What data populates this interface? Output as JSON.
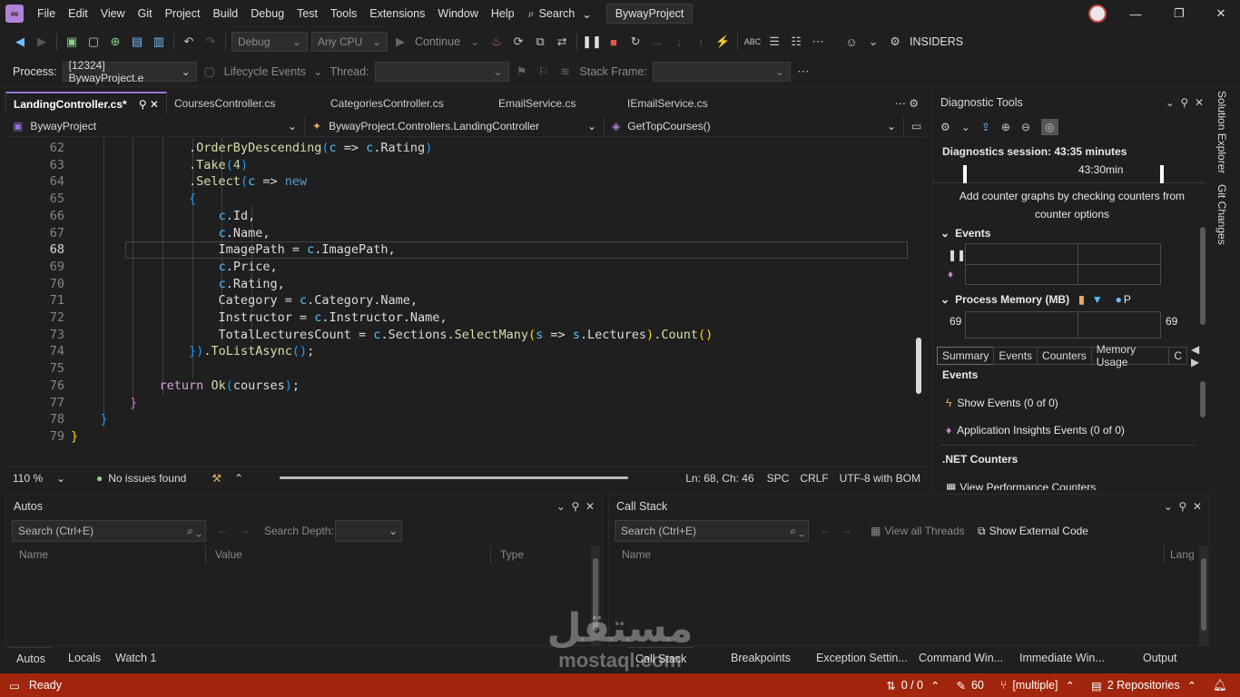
{
  "menubar": {
    "items": [
      "File",
      "Edit",
      "View",
      "Git",
      "Project",
      "Build",
      "Debug",
      "Test",
      "Tools",
      "Extensions",
      "Window",
      "Help"
    ],
    "search_label": "Search",
    "project_name": "BywayProject"
  },
  "toolbar": {
    "config": "Debug",
    "platform": "Any CPU",
    "continue_label": "Continue",
    "insiders_label": "INSIDERS"
  },
  "process_bar": {
    "process_label": "Process:",
    "process_value": "[12324] BywayProject.e",
    "lifecycle_label": "Lifecycle Events",
    "thread_label": "Thread:",
    "stack_frame_label": "Stack Frame:"
  },
  "doc_tabs": [
    {
      "label": "LandingController.cs*",
      "active": true
    },
    {
      "label": "CoursesController.cs"
    },
    {
      "label": "CategoriesController.cs"
    },
    {
      "label": "EmailService.cs"
    },
    {
      "label": "IEmailService.cs"
    }
  ],
  "nav": {
    "project": "BywayProject",
    "class": "BywayProject.Controllers.LandingController",
    "member": "GetTopCourses()"
  },
  "code_lines": [
    {
      "n": "62"
    },
    {
      "n": "63"
    },
    {
      "n": "64"
    },
    {
      "n": "65"
    },
    {
      "n": "66"
    },
    {
      "n": "67"
    },
    {
      "n": "68"
    },
    {
      "n": "69"
    },
    {
      "n": "70"
    },
    {
      "n": "71"
    },
    {
      "n": "72"
    },
    {
      "n": "73"
    },
    {
      "n": "74"
    },
    {
      "n": "75"
    },
    {
      "n": "76"
    },
    {
      "n": "77"
    },
    {
      "n": "78"
    },
    {
      "n": "79"
    }
  ],
  "editor_status": {
    "zoom": "110 %",
    "issues": "No issues found",
    "position": "Ln: 68, Ch: 46",
    "whitespace": "SPC",
    "line_ending": "CRLF",
    "encoding": "UTF-8 with BOM"
  },
  "diagnostic": {
    "title": "Diagnostic Tools",
    "session": "Diagnostics session: 43:35 minutes",
    "timeline_label": "43:30min",
    "hint": "Add counter graphs by checking counters from counter options",
    "events_label": "Events",
    "memory_label": "Process Memory (MB)",
    "memory_legend_p": "P",
    "memory_left": "69",
    "memory_right": "69",
    "subtabs": [
      "Summary",
      "Events",
      "Counters",
      "Memory Usage",
      "C"
    ],
    "summary_events_heading": "Events",
    "show_events": "Show Events (0 of 0)",
    "app_insights": "Application Insights Events (0 of 0)",
    "net_counters": ".NET Counters",
    "view_perf": "View Performance Counters"
  },
  "side_tabs": [
    "Solution Explorer",
    "Git Changes"
  ],
  "autos": {
    "title": "Autos",
    "search_placeholder": "Search (Ctrl+E)",
    "search_depth": "Search Depth:",
    "columns": [
      "Name",
      "Value",
      "Type"
    ]
  },
  "callstack": {
    "title": "Call Stack",
    "search_placeholder": "Search (Ctrl+E)",
    "view_threads": "View all Threads",
    "show_external": "Show External Code",
    "columns": [
      "Name",
      "Lang"
    ]
  },
  "bottom_tabs_left": [
    "Autos",
    "Locals",
    "Watch 1"
  ],
  "bottom_tabs_right": [
    "Call Stack",
    "Breakpoints",
    "Exception Settin...",
    "Command Win...",
    "Immediate Win...",
    "Output"
  ],
  "statusbar": {
    "ready": "Ready",
    "sync": "0 / 0",
    "edits": "60",
    "branch": "[multiple]",
    "repos": "2 Repositories"
  },
  "watermark": {
    "arabic": "مستقل",
    "latin": "mostaql.com"
  },
  "colors": {
    "accent": "#9a72d8",
    "statusbar": "#a1260d",
    "background": "#1f1f1f"
  }
}
